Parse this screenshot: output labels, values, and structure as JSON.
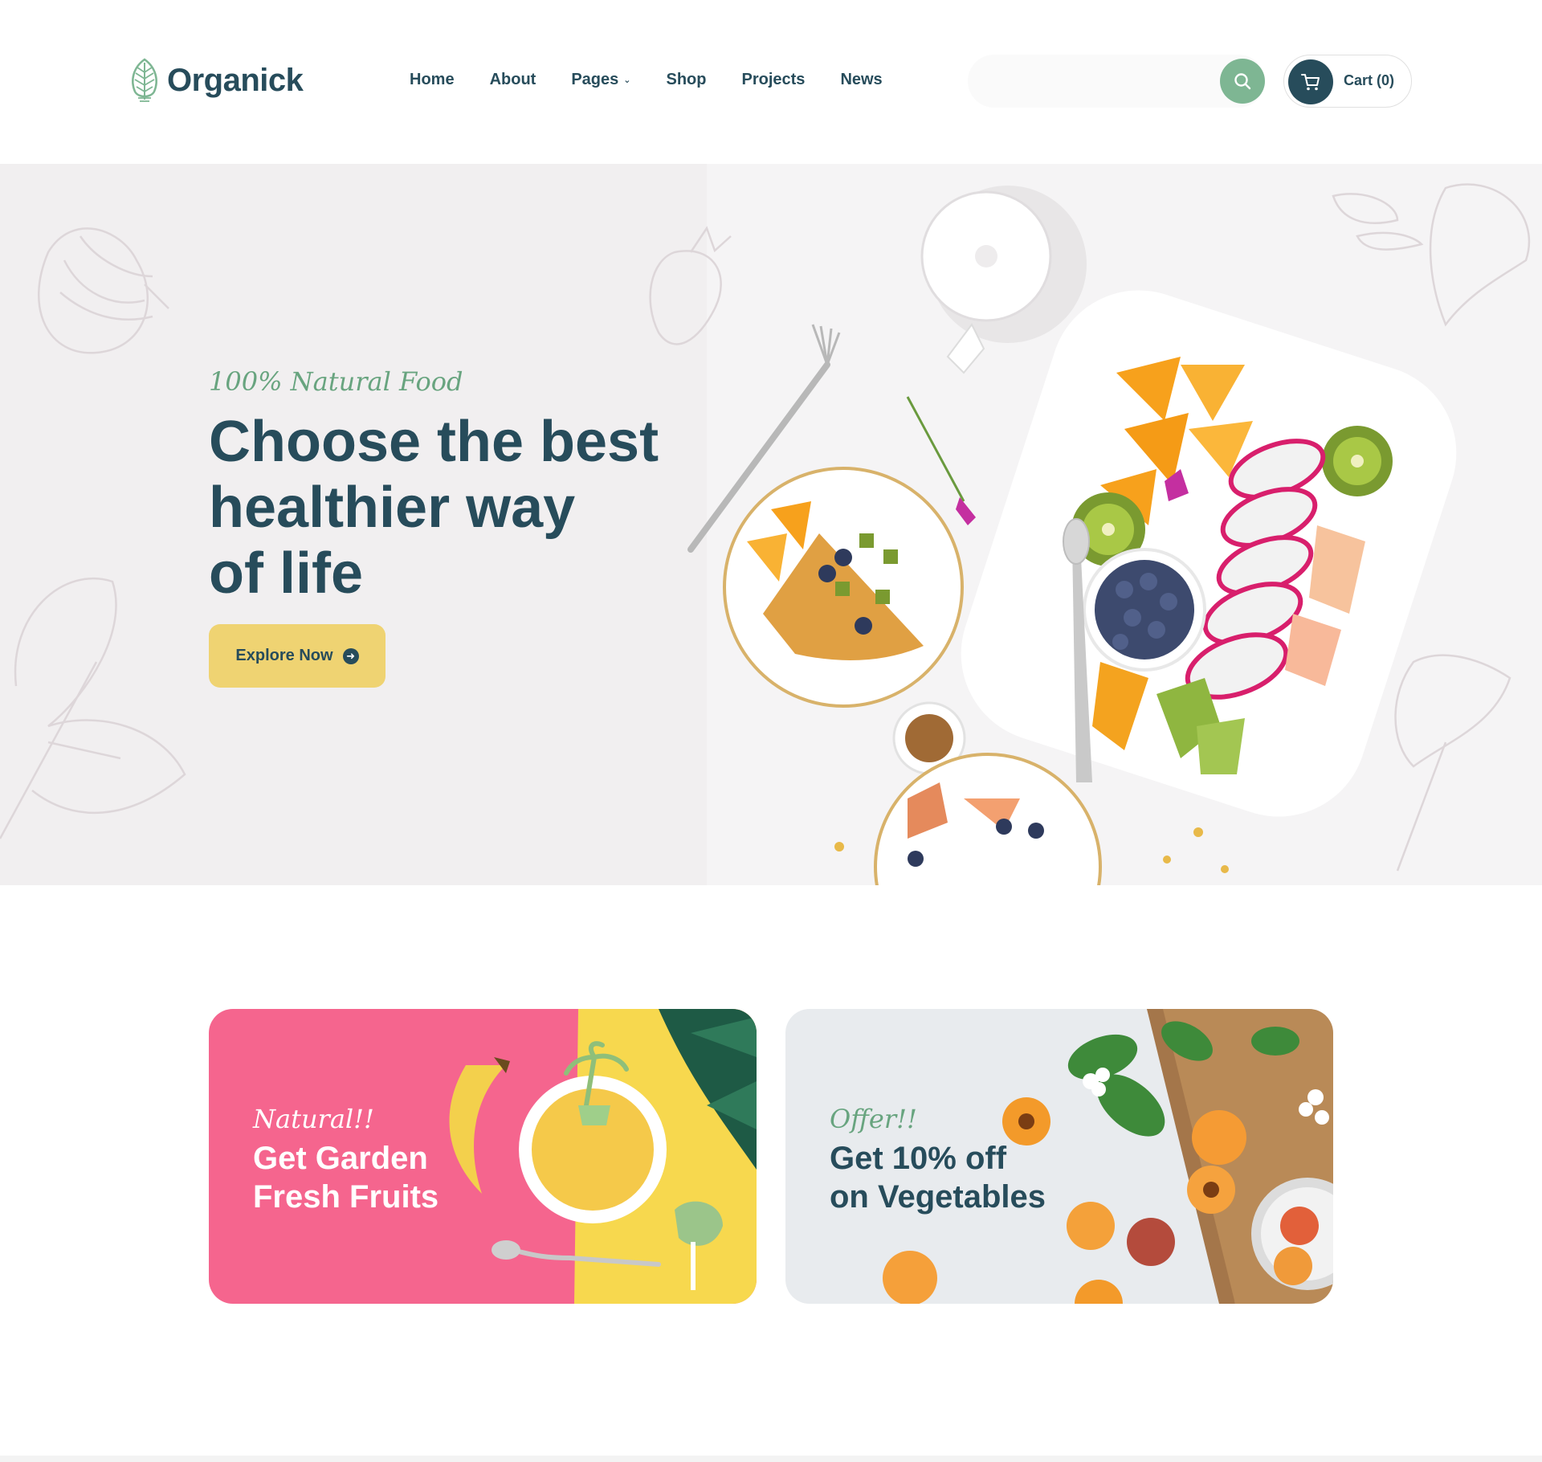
{
  "brand": {
    "name": "Organick",
    "logo_icon": "leaf-logo-icon",
    "brand_color": "#274c5b",
    "accent_green": "#7eb693"
  },
  "nav": {
    "items": [
      {
        "label": "Home"
      },
      {
        "label": "About"
      },
      {
        "label": "Pages",
        "has_dropdown": true
      },
      {
        "label": "Shop"
      },
      {
        "label": "Projects"
      },
      {
        "label": "News"
      }
    ]
  },
  "search": {
    "value": "",
    "icon": "search-icon"
  },
  "cart": {
    "label": "Cart (0)",
    "icon": "cart-icon"
  },
  "hero": {
    "tagline": "100% Natural Food",
    "title_lines": [
      "Choose the best",
      "healthier way",
      "of life"
    ],
    "button_label": "Explore Now",
    "button_color": "#efd372",
    "background": "#f1eff0"
  },
  "offers": [
    {
      "tag": "Natural!!",
      "title_lines": [
        "Get Garden",
        "Fresh Fruits"
      ],
      "background": "#f5658e"
    },
    {
      "tag": "Offer!!",
      "title_lines": [
        "Get 10% off",
        "on Vegetables"
      ],
      "background": "#e8ebee"
    }
  ]
}
